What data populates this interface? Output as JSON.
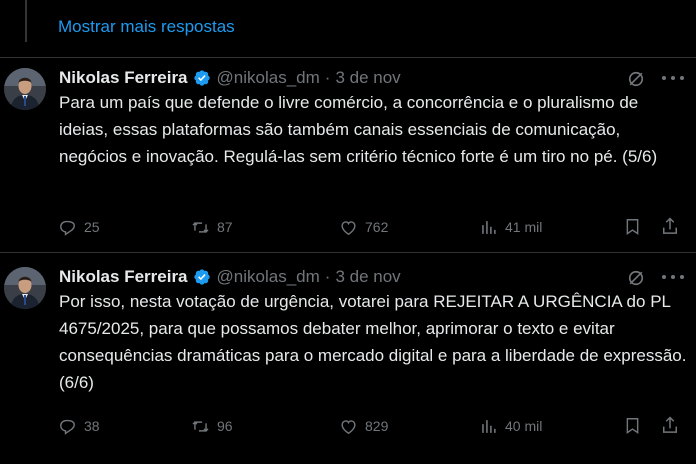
{
  "show_more": "Mostrar mais respostas",
  "tweets": [
    {
      "name": "Nikolas Ferreira",
      "handle": "@nikolas_dm",
      "separator": "·",
      "date": "3 de nov",
      "text": "Para um país que defende o livre comércio, a concorrência e o pluralismo de ideias, essas plataformas são também canais essenciais de comunicação, negócios e inovação. Regulá-las sem critério técnico forte é um tiro no pé. (5/6)",
      "replies": "25",
      "reposts": "87",
      "likes": "762",
      "views": "41 mil"
    },
    {
      "name": "Nikolas Ferreira",
      "handle": "@nikolas_dm",
      "separator": "·",
      "date": "3 de nov",
      "text": "Por isso, nesta votação de urgência, votarei para REJEITAR A URGÊNCIA do PL 4675/2025, para que possamos debater melhor, aprimorar o texto e evitar consequências dramáticas para o mercado digital e para a liberdade de expressão.  (6/6)",
      "replies": "38",
      "reposts": "96",
      "likes": "829",
      "views": "40 mil"
    }
  ],
  "icons": {
    "reply": "reply-icon",
    "repost": "repost-icon",
    "like": "like-icon",
    "views": "views-icon",
    "bookmark": "bookmark-icon",
    "share": "share-icon",
    "grok": "grok-icon",
    "verified": "verified-badge-icon",
    "more": "more-options-icon"
  },
  "colors": {
    "background": "#000000",
    "link": "#1d9bf0",
    "text": "#e7e9ea",
    "muted": "#71767b",
    "verified": "#1d9bf0"
  }
}
